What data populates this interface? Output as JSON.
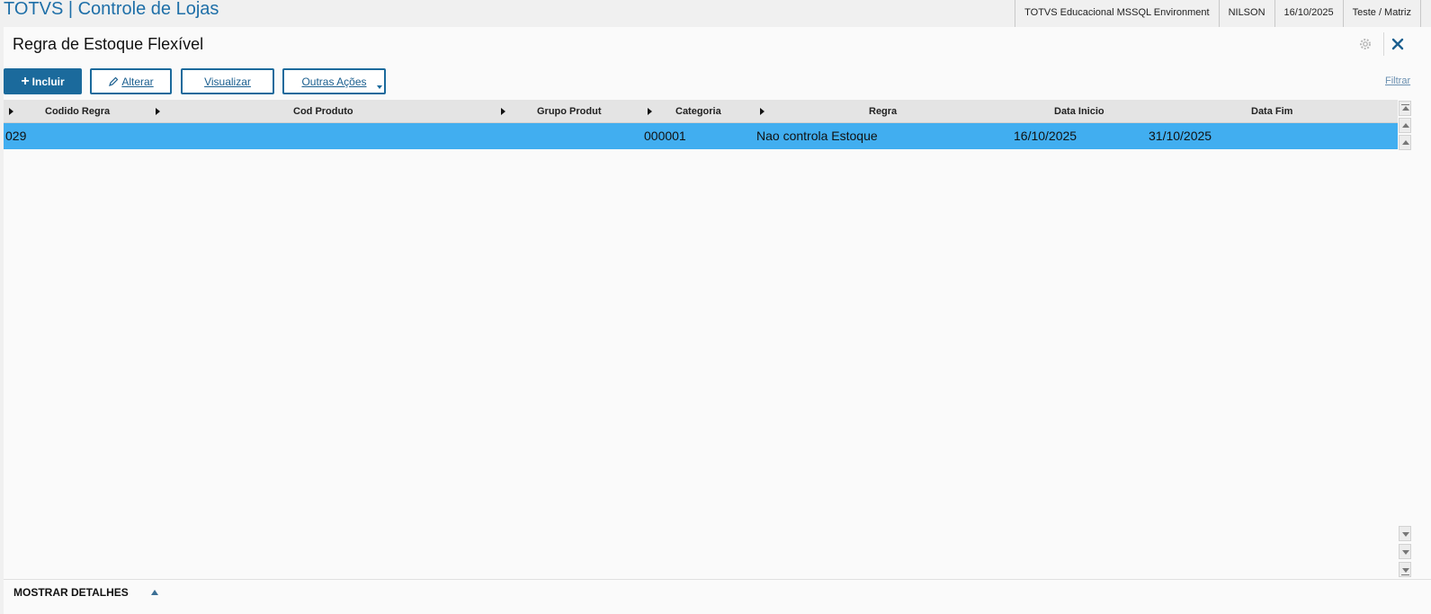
{
  "topbar": {
    "app_title": "TOTVS | Controle de Lojas",
    "environment": "TOTVS Educacional MSSQL Environment",
    "user": "NILSON",
    "date": "16/10/2025",
    "branch": "Teste / Matriz"
  },
  "page": {
    "title": "Regra de Estoque Flexível"
  },
  "toolbar": {
    "include_label": "Incluir",
    "alter_label": "Alterar",
    "view_label": "Visualizar",
    "other_actions_label": "Outras Ações",
    "filter_label": "Filtrar"
  },
  "grid": {
    "columns": [
      "Codido Regra",
      "Cod Produto",
      "Grupo Produt",
      "Categoria",
      "Regra",
      "Data Inicio",
      "Data Fim"
    ],
    "rows": [
      [
        "029",
        "",
        "",
        "000001",
        "Nao controla Estoque",
        "16/10/2025",
        "31/10/2025"
      ]
    ]
  },
  "footer": {
    "details_label": "MOSTRAR DETALHES"
  },
  "colors": {
    "brand_blue": "#1b6a9c",
    "selected_row": "#41aef0",
    "title_blue": "#1e6fa8"
  }
}
